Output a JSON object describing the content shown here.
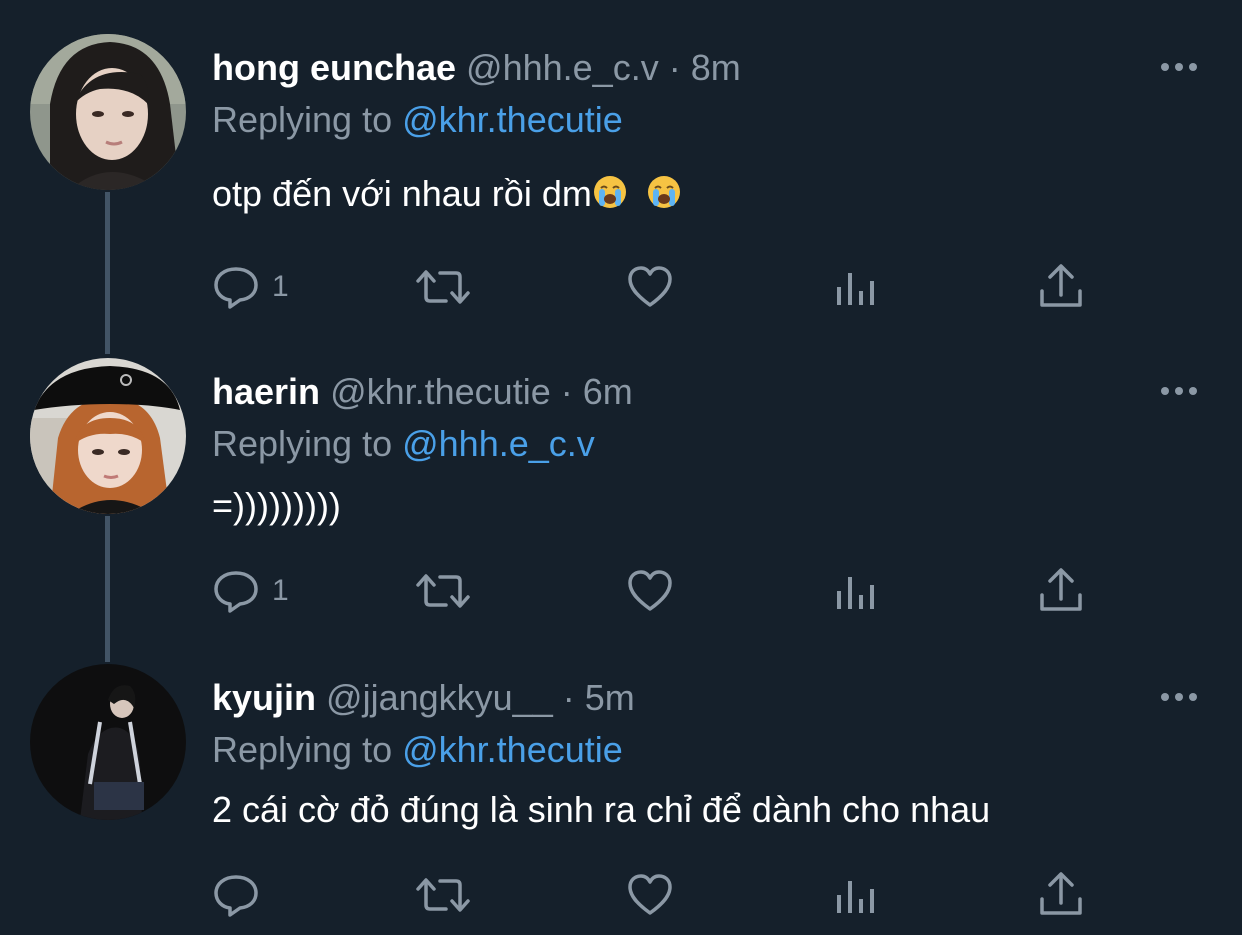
{
  "tweets": [
    {
      "name": "hong eunchae",
      "handle": "@hhh.e_c.v",
      "separator": "·",
      "time": "8m",
      "replying_prefix": "Replying to ",
      "replying_to": "@khr.thecutie",
      "text": "otp đến với nhau rồi dm",
      "emoji": [
        "loudly-crying-face",
        "loudly-crying-face"
      ],
      "reply_count": "1",
      "avatar": "woman-dark-hair-photo"
    },
    {
      "name": "haerin",
      "handle": "@khr.thecutie",
      "separator": "·",
      "time": "6m",
      "replying_prefix": "Replying to ",
      "replying_to": "@hhh.e_c.v",
      "text": "=)))))))))",
      "reply_count": "1",
      "avatar": "girl-black-beret-photo"
    },
    {
      "name": "kyujin",
      "handle": "@jjangkkyu__",
      "separator": "·",
      "time": "5m",
      "replying_prefix": "Replying to ",
      "replying_to": "@khr.thecutie",
      "text": "2 cái cờ đỏ đúng là sinh ra chỉ để dành cho nhau",
      "reply_count": "",
      "avatar": "girl-dark-background-photo"
    }
  ],
  "icons": {
    "reply": "reply-icon",
    "retweet": "retweet-icon",
    "like": "heart-icon",
    "views": "views-icon",
    "share": "share-icon",
    "more": "more-icon"
  },
  "colors": {
    "background": "#15202b",
    "text": "#ffffff",
    "secondary": "#8b98a5",
    "accent": "#4aa0e8",
    "thread_line": "#425466"
  }
}
